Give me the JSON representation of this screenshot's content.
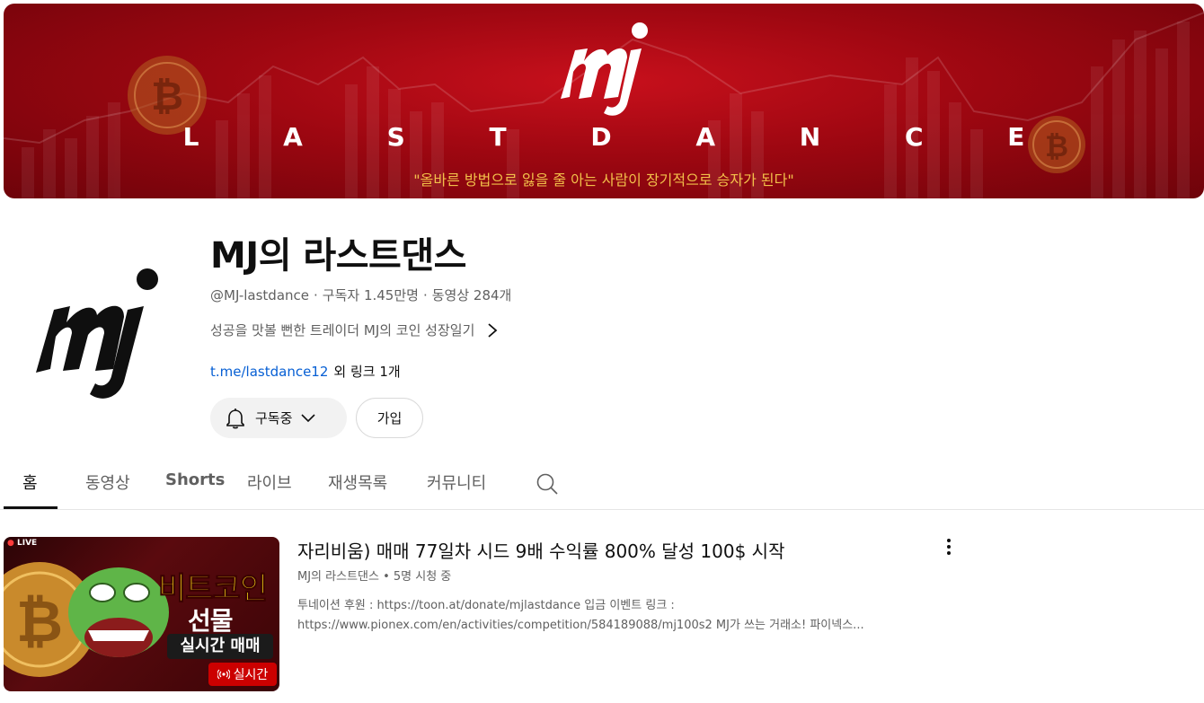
{
  "banner": {
    "title": "L A S T D A N C E",
    "tagline": "\"올바른 방법으로 잃을 줄 아는 사람이 장기적으로 승자가 된다\"",
    "logo_icon": "mj-logo-icon"
  },
  "channel": {
    "name": "MJ의 라스트댄스",
    "handle": "@MJ-lastdance",
    "subscribers": "구독자 1.45만명",
    "videos": "동영상 284개",
    "description": "성공을 맛볼 뻔한 트레이더 MJ의 코인 성장일기",
    "link": "t.me/lastdance12",
    "more_links": "외 링크 1개"
  },
  "buttons": {
    "subscribed": "구독중",
    "join": "가입"
  },
  "tabs": [
    {
      "label": "홈"
    },
    {
      "label": "동영상"
    },
    {
      "label": "Shorts"
    },
    {
      "label": "라이브"
    },
    {
      "label": "재생목록"
    },
    {
      "label": "커뮤니티"
    }
  ],
  "video": {
    "title": "자리비움) 매매 77일차 시드 9배 수익률 800% 달성 100$ 시작",
    "channel": "MJ의 라스트댄스",
    "watching": "5명 시청 중",
    "description_line1": "투네이션 후원 : https://toon.at/donate/mjlastdance 입금 이벤트 링크 :",
    "description_line2": "https://www.pionex.com/en/activities/competition/584189088/mj100s2 MJ가 쓰는 거래소! 파이넥스...",
    "thumbnail": {
      "live_tag": "LIVE",
      "line1": "비트코인",
      "line2": "선물",
      "line3": "실시간 매매",
      "badge": "실시간"
    }
  },
  "colors": {
    "accent_red": "#cc0000",
    "link_blue": "#065fd4",
    "banner_red": "#9e0711",
    "tagline_gold": "#f2c04a"
  }
}
